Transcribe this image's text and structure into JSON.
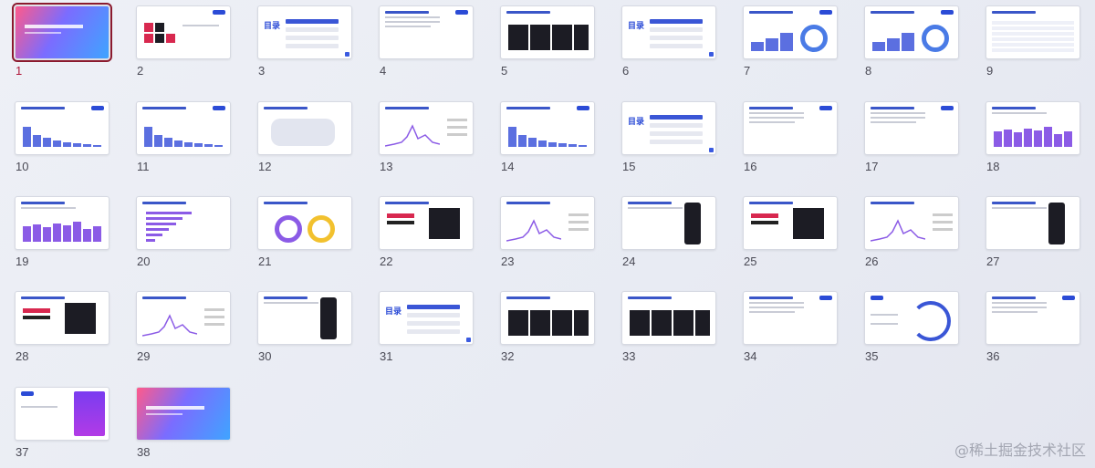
{
  "slides": [
    {
      "num": "1",
      "type": "cover",
      "selected": true
    },
    {
      "num": "2",
      "type": "logos"
    },
    {
      "num": "3",
      "type": "toc"
    },
    {
      "num": "4",
      "type": "text"
    },
    {
      "num": "5",
      "type": "images"
    },
    {
      "num": "6",
      "type": "toc"
    },
    {
      "num": "7",
      "type": "chart-donut"
    },
    {
      "num": "8",
      "type": "chart-donut"
    },
    {
      "num": "9",
      "type": "table"
    },
    {
      "num": "10",
      "type": "bars"
    },
    {
      "num": "11",
      "type": "bars"
    },
    {
      "num": "12",
      "type": "map"
    },
    {
      "num": "13",
      "type": "line"
    },
    {
      "num": "14",
      "type": "bars"
    },
    {
      "num": "15",
      "type": "toc"
    },
    {
      "num": "16",
      "type": "list"
    },
    {
      "num": "17",
      "type": "list"
    },
    {
      "num": "18",
      "type": "bars-purple"
    },
    {
      "num": "19",
      "type": "bars-purple"
    },
    {
      "num": "20",
      "type": "hbars"
    },
    {
      "num": "21",
      "type": "pie"
    },
    {
      "num": "22",
      "type": "brand"
    },
    {
      "num": "23",
      "type": "line"
    },
    {
      "num": "24",
      "type": "phone"
    },
    {
      "num": "25",
      "type": "brand"
    },
    {
      "num": "26",
      "type": "line"
    },
    {
      "num": "27",
      "type": "phone"
    },
    {
      "num": "28",
      "type": "brand"
    },
    {
      "num": "29",
      "type": "line"
    },
    {
      "num": "30",
      "type": "phone"
    },
    {
      "num": "31",
      "type": "toc"
    },
    {
      "num": "32",
      "type": "images"
    },
    {
      "num": "33",
      "type": "images"
    },
    {
      "num": "34",
      "type": "text"
    },
    {
      "num": "35",
      "type": "diagram"
    },
    {
      "num": "36",
      "type": "text"
    },
    {
      "num": "37",
      "type": "card"
    },
    {
      "num": "38",
      "type": "cover"
    }
  ],
  "toc_label": "目录",
  "watermark": "@稀土掘金技术社区",
  "colors": {
    "accent": "#3a56c8",
    "selected": "#8b1a2e",
    "purple": "#8b5be6"
  }
}
